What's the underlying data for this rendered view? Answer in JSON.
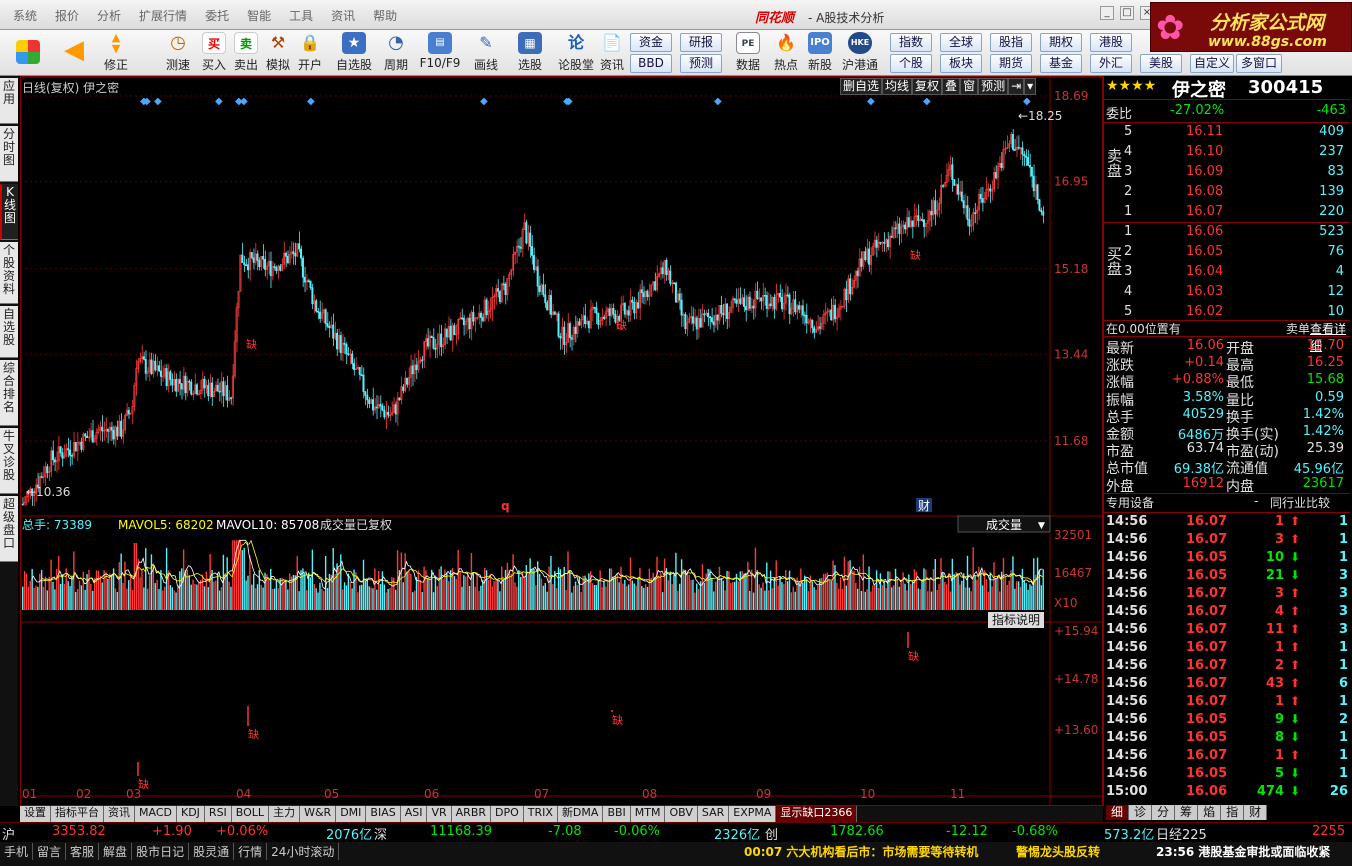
{
  "menu": {
    "items": [
      "系统",
      "报价",
      "分析",
      "扩展行情",
      "委托",
      "智能",
      "工具",
      "资讯",
      "帮助"
    ],
    "brand": "同花顺",
    "title": "- A股技术分析"
  },
  "window": {
    "min": "_",
    "max": "□",
    "close": "×"
  },
  "toolbar": {
    "items": [
      "修正",
      "测速",
      "买入",
      "卖出",
      "模拟",
      "开户",
      "自选股",
      "周期",
      "F10/F9",
      "画线",
      "选股",
      "论股堂",
      "资讯",
      "数据",
      "热点",
      "新股",
      "沪港通"
    ],
    "icons": {
      "buy": "买",
      "sell": "卖",
      "lun": "论"
    },
    "btns": [
      "资金",
      "研报",
      "BBD",
      "预测",
      "指数",
      "全球",
      "股指",
      "期权",
      "港股",
      "个股",
      "板块",
      "期货",
      "基金",
      "外汇",
      "美股",
      "自定义",
      "多窗口"
    ]
  },
  "logo": {
    "line1": "分析家公式网",
    "line2": "www.88gs.com"
  },
  "sidetabs": [
    "应用",
    "分时图",
    "K线图",
    "个股资料",
    "自选股",
    "综合排名",
    "牛叉诊股",
    "超级盘口"
  ],
  "chart_header": {
    "title": "日线(复权) 伊之密",
    "buttons": [
      "删自选",
      "均线",
      "复权",
      "叠",
      "窗",
      "预测"
    ]
  },
  "chart_data": {
    "type": "candlestick",
    "title": "日线(复权) 伊之密",
    "price_ticks": [
      "18.69",
      "16.95",
      "15.18",
      "13.44",
      "11.68"
    ],
    "high_label": "18.25",
    "low_label": "10.36",
    "ylim": [
      10.36,
      18.69
    ],
    "months": [
      "01",
      "02",
      "03",
      "04",
      "05",
      "06",
      "07",
      "08",
      "09",
      "10",
      "11"
    ],
    "markers": [
      "q",
      "财"
    ],
    "gap_label": "缺",
    "volume": {
      "header_total": "总手: 73389",
      "header_ma5": "MAVOL5: 68202",
      "header_ma10": "MAVOL10: 85708",
      "note": "成交量已复权",
      "selector": "成交量",
      "ticks": [
        "32501",
        "16467"
      ],
      "unit": "X10"
    },
    "indicator": {
      "button": "指标说明",
      "ticks": [
        "+15.94",
        "+14.78",
        "+13.60"
      ]
    }
  },
  "stock": {
    "stars": "★★★★",
    "name": "伊之密",
    "code": "300415"
  },
  "weibi": {
    "label": "委比",
    "pct": "-27.02%",
    "val": "-463"
  },
  "sell_orders": [
    [
      "5",
      "16.11",
      "409"
    ],
    [
      "4",
      "16.10",
      "237"
    ],
    [
      "3",
      "16.09",
      "83"
    ],
    [
      "2",
      "16.08",
      "139"
    ],
    [
      "1",
      "16.07",
      "220"
    ]
  ],
  "buy_orders": [
    [
      "1",
      "16.06",
      "523"
    ],
    [
      "2",
      "16.05",
      "76"
    ],
    [
      "3",
      "16.04",
      "4"
    ],
    [
      "4",
      "16.03",
      "12"
    ],
    [
      "5",
      "16.02",
      "10"
    ]
  ],
  "sell_label": "卖盘",
  "buy_label": "买盘",
  "pos_note": {
    "left": "在0.00位置有",
    "right": "卖单",
    "link": "查看详细"
  },
  "quote": [
    [
      "最新",
      "16.06",
      "开盘",
      "15.70"
    ],
    [
      "涨跌",
      "+0.14",
      "最高",
      "16.25"
    ],
    [
      "涨幅",
      "+0.88%",
      "最低",
      "15.68"
    ],
    [
      "振幅",
      "3.58%",
      "量比",
      "0.59"
    ],
    [
      "总手",
      "40529",
      "换手",
      "1.42%"
    ],
    [
      "金额",
      "6486万",
      "换手(实)",
      "1.42%"
    ],
    [
      "市盈",
      "63.74",
      "市盈(动)",
      "25.39"
    ],
    [
      "总市值",
      "69.38亿",
      "流通值",
      "45.96亿"
    ],
    [
      "外盘",
      "16912",
      "内盘",
      "23617"
    ]
  ],
  "ticks_header": {
    "left": "专用设备",
    "dash": "-",
    "right": "同行业比较"
  },
  "trades": [
    [
      "14:56",
      "16.07",
      "1",
      "up",
      "1"
    ],
    [
      "14:56",
      "16.07",
      "3",
      "up",
      "1"
    ],
    [
      "14:56",
      "16.05",
      "10",
      "dn",
      "1"
    ],
    [
      "14:56",
      "16.05",
      "21",
      "dn",
      "3"
    ],
    [
      "14:56",
      "16.07",
      "3",
      "up",
      "3"
    ],
    [
      "14:56",
      "16.07",
      "4",
      "up",
      "3"
    ],
    [
      "14:56",
      "16.07",
      "11",
      "up",
      "3"
    ],
    [
      "14:56",
      "16.07",
      "1",
      "up",
      "1"
    ],
    [
      "14:56",
      "16.07",
      "2",
      "up",
      "1"
    ],
    [
      "14:56",
      "16.07",
      "43",
      "up",
      "6"
    ],
    [
      "14:56",
      "16.07",
      "1",
      "up",
      "1"
    ],
    [
      "14:56",
      "16.05",
      "9",
      "dn",
      "2"
    ],
    [
      "14:56",
      "16.05",
      "8",
      "dn",
      "1"
    ],
    [
      "14:56",
      "16.07",
      "1",
      "up",
      "1"
    ],
    [
      "14:56",
      "16.05",
      "5",
      "dn",
      "1"
    ],
    [
      "15:00",
      "16.06",
      "474",
      "dn",
      "26"
    ]
  ],
  "detail_tabs": [
    "细",
    "诊",
    "分",
    "筹",
    "焰",
    "指",
    "财"
  ],
  "bottom_tabs": [
    "设置",
    "指标平台",
    "资讯",
    "MACD",
    "KDJ",
    "RSI",
    "BOLL",
    "主力",
    "W&R",
    "DMI",
    "BIAS",
    "ASI",
    "VR",
    "ARBR",
    "DPO",
    "TRIX",
    "新DMA",
    "BBI",
    "MTM",
    "OBV",
    "SAR",
    "EXPMA",
    "显示缺口2366"
  ],
  "index_bar": {
    "sh": "沪",
    "sh_val": "3353.82",
    "sh_chg": "+1.90",
    "sh_pct": "+0.06%",
    "sh_amt": "2076亿",
    "sz": "深",
    "sz_val": "11168.39",
    "sz_chg": "-7.08",
    "sz_pct": "-0.06%",
    "sz_amt": "2326亿",
    "cy": "创",
    "cy_val": "1782.66",
    "cy_chg": "-12.12",
    "cy_pct": "-0.68%",
    "cy_amt": "573.2亿",
    "rj": "日经225",
    "rj_val": "2255"
  },
  "footer": {
    "items": [
      "手机",
      "留言",
      "客服",
      "解盘",
      "股市日记",
      "股灵通",
      "行情",
      "24小时滚动"
    ],
    "news1": "00:07 六大机构看后市：市场需要等待转机",
    "news2": "警惕龙头股反转",
    "news3": "23:56 港股基金审批或面临收紧"
  }
}
